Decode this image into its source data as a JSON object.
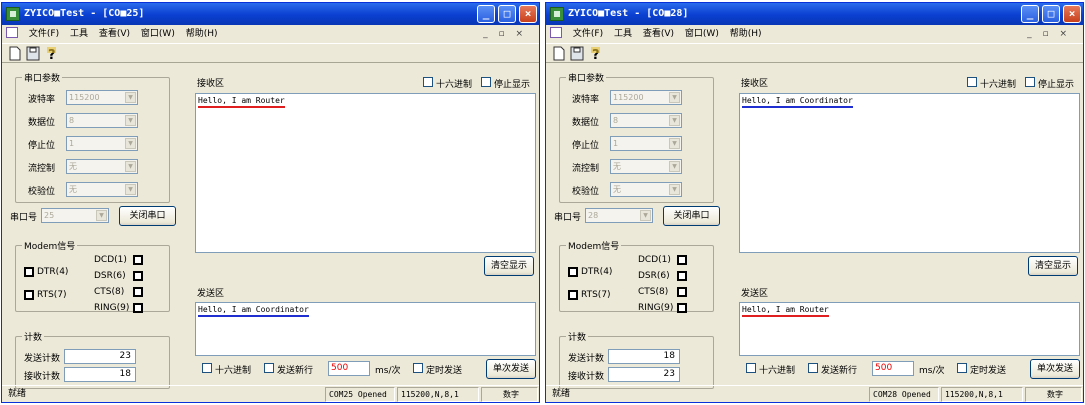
{
  "windows": [
    {
      "title": "ZYICO■Test - [CO■25]",
      "menus": [
        "文件(F)",
        "工具",
        "查看(V)",
        "窗口(W)",
        "帮助(H)"
      ],
      "serial": {
        "group_title": "串口参数",
        "baud_label": "波特率",
        "baud_value": "115200",
        "data_label": "数据位",
        "data_value": "8",
        "stop_label": "停止位",
        "stop_value": "1",
        "flow_label": "流控制",
        "flow_value": "无",
        "parity_label": "校验位",
        "parity_value": "无"
      },
      "port_label": "串口号",
      "port_value": "25",
      "close_port_label": "关闭串口",
      "modem": {
        "title": "Modem信号",
        "dtr": "DTR(4)",
        "rts": "RTS(7)",
        "dcd": "DCD(1)",
        "dsr": "DSR(6)",
        "cts": "CTS(8)",
        "ring": "RING(9)"
      },
      "counts": {
        "title": "计数",
        "send_label": "发送计数",
        "send_value": "23",
        "recv_label": "接收计数",
        "recv_value": "18"
      },
      "receive": {
        "title": "接收区",
        "hex_label": "十六进制",
        "stop_label": "停止显示",
        "text": "Hello, I am Router",
        "underline_color": "#e02020",
        "clear_label": "清空显示"
      },
      "send": {
        "title": "发送区",
        "text": "Hello, I am Coordinator",
        "underline_color": "#2030d0",
        "hex_label": "十六进制",
        "newline_label": "发送新行",
        "interval": "500",
        "interval_unit": "ms/次",
        "timer_label": "定时发送",
        "send_once_label": "单次发送"
      },
      "status": {
        "ready": "就绪",
        "port": "COM25 Opened",
        "settings": "115200,N,8,1",
        "mode": "数字"
      }
    },
    {
      "title": "ZYICO■Test - [CO■28]",
      "menus": [
        "文件(F)",
        "工具",
        "查看(V)",
        "窗口(W)",
        "帮助(H)"
      ],
      "serial": {
        "group_title": "串口参数",
        "baud_label": "波特率",
        "baud_value": "115200",
        "data_label": "数据位",
        "data_value": "8",
        "stop_label": "停止位",
        "stop_value": "1",
        "flow_label": "流控制",
        "flow_value": "无",
        "parity_label": "校验位",
        "parity_value": "无"
      },
      "port_label": "串口号",
      "port_value": "28",
      "close_port_label": "关闭串口",
      "modem": {
        "title": "Modem信号",
        "dtr": "DTR(4)",
        "rts": "RTS(7)",
        "dcd": "DCD(1)",
        "dsr": "DSR(6)",
        "cts": "CTS(8)",
        "ring": "RING(9)"
      },
      "counts": {
        "title": "计数",
        "send_label": "发送计数",
        "send_value": "18",
        "recv_label": "接收计数",
        "recv_value": "23"
      },
      "receive": {
        "title": "接收区",
        "hex_label": "十六进制",
        "stop_label": "停止显示",
        "text": "Hello, I am Coordinator",
        "underline_color": "#2030d0",
        "clear_label": "清空显示"
      },
      "send": {
        "title": "发送区",
        "text": "Hello, I am Router",
        "underline_color": "#e02020",
        "hex_label": "十六进制",
        "newline_label": "发送新行",
        "interval": "500",
        "interval_unit": "ms/次",
        "timer_label": "定时发送",
        "send_once_label": "单次发送"
      },
      "status": {
        "ready": "就绪",
        "port": "COM28 Opened",
        "settings": "115200,N,8,1",
        "mode": "数字"
      }
    }
  ]
}
